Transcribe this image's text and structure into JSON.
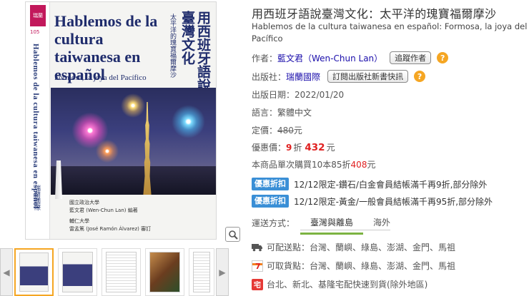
{
  "book": {
    "title_zh": "用西班牙語說臺灣文化：太平洋的瑰寶福爾摩沙",
    "title_es": "Hablemos de la cultura taiwanesa en español: Formosa, la joya del Pacífico"
  },
  "cover": {
    "series_badge": "瑞蘭",
    "series_number": "105",
    "title_es": "Hablemos de la cultura taiwanesa en español",
    "subtitle_es": "Formosa, la joya del Pacífico",
    "title_zh": "用西班牙語說臺灣文化",
    "subtitle_zh": "太平洋的瑰寶福爾摩沙",
    "spine_title": "Hablemos de la cultura taiwanesa en español",
    "spine_publisher": "瑞蘭國際",
    "credit_school1": "國立政治大學",
    "credit_author": "藍文君 (Wen-Chun Lan) 編著",
    "credit_school2": "輔仁大學",
    "credit_reviewer": "雷孟篤 (José Ramón Álvarez) 審訂"
  },
  "details": {
    "author_label": "作者：",
    "author": "藍文君（Wen-Chun Lan）",
    "follow_author_button": "追蹤作者",
    "publisher_label": "出版社：",
    "publisher": "瑞蘭國際",
    "subscribe_button": "訂閱出版社新書快訊",
    "pubdate_label": "出版日期：",
    "pubdate": "2022/01/20",
    "language_label": "語言：",
    "language": "繁體中文"
  },
  "price": {
    "list_label": "定價：",
    "list_price": "480",
    "list_unit": "元",
    "sale_label": "優惠價：",
    "discount": "9",
    "discount_unit": "折",
    "sale_price": "432",
    "sale_unit": "元",
    "bulk_text": "本商品單次購買10本85折",
    "bulk_price": "408",
    "bulk_unit": "元"
  },
  "promos": [
    {
      "tag": "優惠折扣",
      "text": "12/12限定-鑽石/白金會員結帳滿千再9折,部分除外"
    },
    {
      "tag": "優惠折扣",
      "text": "12/12限定-黃金/一般會員結帳滿千再95折,部分除外"
    }
  ],
  "shipping": {
    "label": "運送方式：",
    "tabs": [
      "臺灣與離島",
      "海外"
    ],
    "deliver_label": "可配送點：",
    "deliver_areas": "台灣、蘭嶼、綠島、澎湖、金門、馬祖",
    "pickup_label": "可取貨點：",
    "pickup_areas": "台灣、蘭嶼、綠島、澎湖、金門、馬祖",
    "express_text": "台北、新北、基隆宅配快速到貨(除外地區)"
  },
  "icons": {
    "zoom": "magnifier-icon",
    "help": "question-icon",
    "truck": "truck-icon",
    "seven": "seven-eleven-icon",
    "express": "express-icon"
  },
  "colors": {
    "accent": "#f5a623",
    "price": "#e02020",
    "promo": "#3a8fd6",
    "tab": "#7cb342"
  }
}
